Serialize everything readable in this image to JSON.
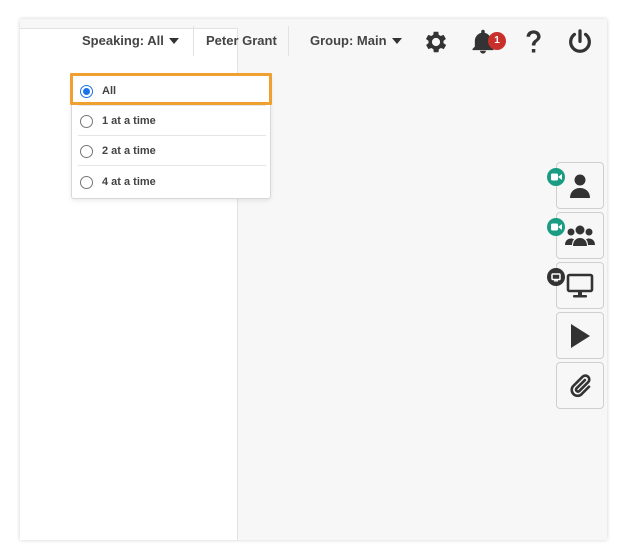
{
  "toolbar": {
    "speaking_label": "Speaking: All",
    "user_name": "Peter Grant",
    "group_label": "Group: Main",
    "notification_count": "1",
    "icons": [
      "gear-icon",
      "bell-icon",
      "help-icon",
      "power-icon"
    ]
  },
  "speaking_menu": {
    "options": [
      {
        "label": "All",
        "selected": true
      },
      {
        "label": "1 at a time",
        "selected": false
      },
      {
        "label": "2 at a time",
        "selected": false
      },
      {
        "label": "4 at a time",
        "selected": false
      }
    ]
  },
  "side_panel": {
    "buttons": [
      "single-user-icon",
      "group-icon",
      "screen-share-icon",
      "play-icon",
      "paperclip-icon"
    ]
  },
  "colors": {
    "accent_focus": "#f0a030",
    "radio_selected": "#1a73e8",
    "badge_red": "#c9302c",
    "cam_green": "#1a9c83",
    "icon_dark": "#333333"
  }
}
